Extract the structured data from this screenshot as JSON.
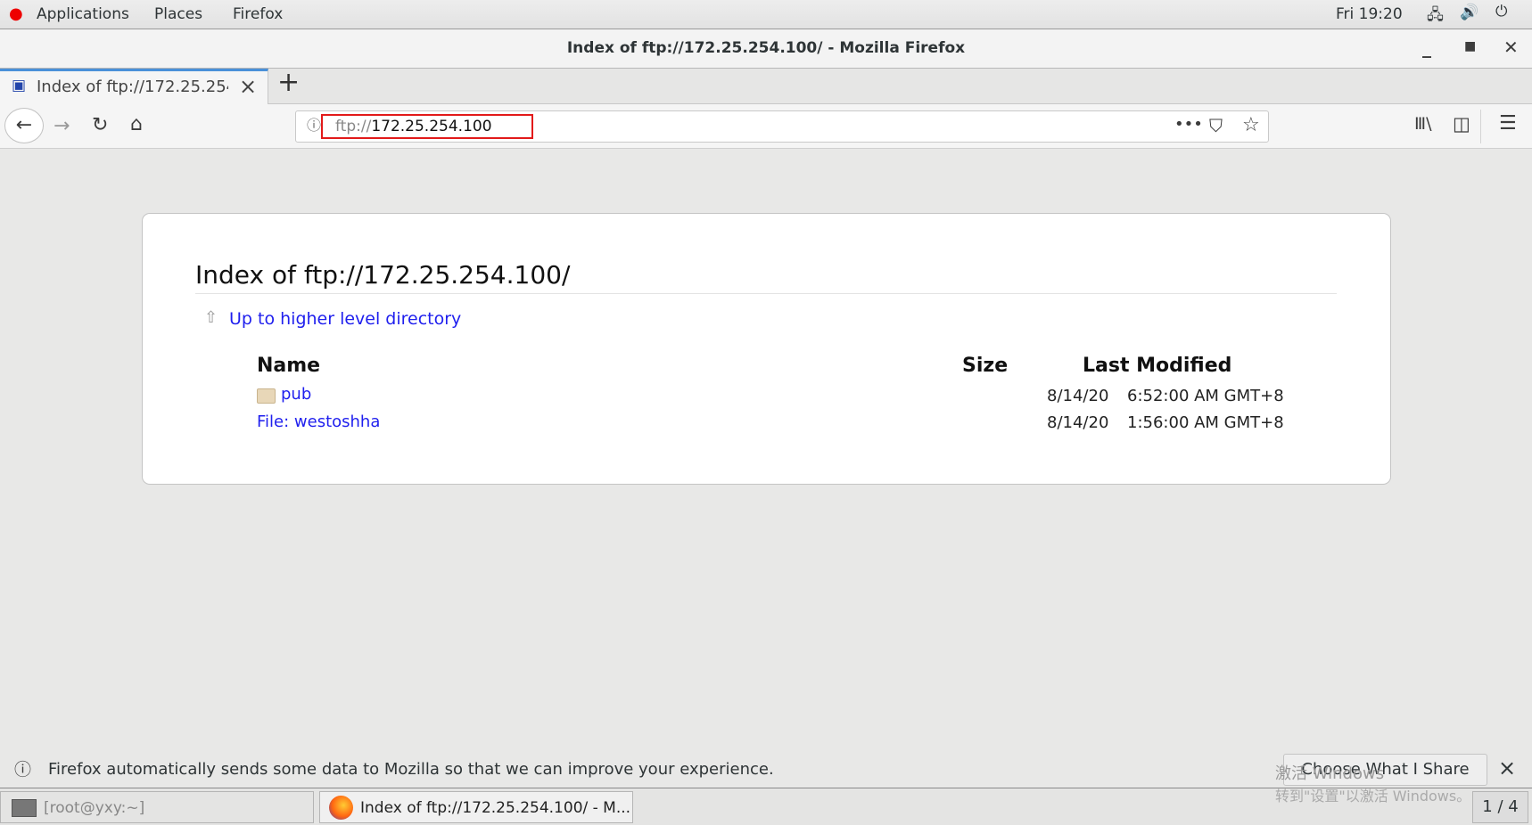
{
  "topbar": {
    "menus": [
      "Applications",
      "Places",
      "Firefox"
    ],
    "clock": "Fri 19:20",
    "icons": [
      "network-icon",
      "volume-icon",
      "power-icon"
    ]
  },
  "window": {
    "title": "Index of ftp://172.25.254.100/ - Mozilla Firefox"
  },
  "tab": {
    "label": "Index of ftp://172.25.254.",
    "close": "×",
    "new_tab": "+"
  },
  "urlbar": {
    "scheme": "ftp://",
    "host": "172.25.254.100",
    "highlight_color": "#e21a1a"
  },
  "page": {
    "heading": "Index of ftp://172.25.254.100/",
    "up_link": "Up to higher level directory",
    "columns": [
      "Name",
      "Size",
      "Last Modified"
    ],
    "rows": [
      {
        "name": "pub",
        "type": "folder",
        "size": "",
        "date": "8/14/20",
        "time": "6:52:00 AM GMT+8"
      },
      {
        "name": "File: westoshha",
        "type": "file",
        "size": "",
        "date": "8/14/20",
        "time": "1:56:00 AM GMT+8"
      }
    ],
    "link_color": "#1f1fee"
  },
  "notification": {
    "text": "Firefox automatically sends some data to Mozilla so that we can improve your experience.",
    "button": "Choose What I Share",
    "close": "×"
  },
  "watermark": {
    "line1": "激活 Windows",
    "line2": "转到\"设置\"以激活 Windows。"
  },
  "taskbar": {
    "items": [
      "[root@yxy:~]",
      "Index of ftp://172.25.254.100/ - M..."
    ],
    "pager": "1 / 4"
  }
}
